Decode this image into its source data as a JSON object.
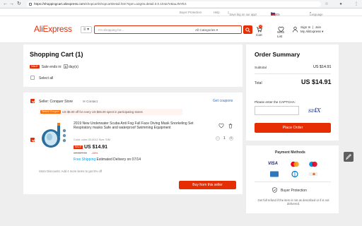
{
  "browser": {
    "url_host": "https://shoppingcart.aliexpress.com",
    "url_path": "/shopcart/shopcartDetail.htm?spm=a2g0o.detail.0.0.104a7e8auJNYE4"
  },
  "topbar": {
    "buyer_protection": "Buyer Protection",
    "help": "Help",
    "app": "Save big on our app!",
    "ship_to": "Ship to",
    "currency": "/ USD",
    "language": "Language"
  },
  "header": {
    "logo": "AliExpress",
    "search_placeholder": "I'm shopping for...",
    "search_categories": "All Categories",
    "cart_label": "Cart",
    "cart_count": "0",
    "wish_label_1": "Wish",
    "wish_label_2": "List",
    "signin": "Sign In",
    "join": "Join",
    "my_aliexpress": "My AliExpress"
  },
  "cart": {
    "title": "Shopping Cart (1)",
    "sale_tag": "SALE",
    "sale_ends": "Sale ends in:",
    "sale_days": "5",
    "sale_days_label": "day(s)",
    "select_all": "Select all"
  },
  "seller": {
    "label": "Seller: Conquer Store",
    "contact": "Contact",
    "get_coupons": "Get coupons",
    "coupon_tag": "Select Coupon",
    "coupon_text": "US $6.00 off for every US $65.00 spent in participating stores"
  },
  "item": {
    "title": "2019 New Underwater Scuba Anti Fog Full Face Diving Mask Snorkeling Set Respiratory masks Safe and waterproof Swimming Equipment",
    "variant": "Color: color-03-0012   Size: S/M",
    "sale_tag": "SALE",
    "price": "US $14.91",
    "original_price": "US $27.00",
    "discount": "-25%",
    "free_shipping": "Free Shipping",
    "delivery": "Estimated Delivery on 07/14",
    "quantity": "1",
    "qty_minus": "−",
    "qty_plus": "+"
  },
  "store_footer": {
    "store_discounts": "Store Discounts: Add 4 more items to get 5% off",
    "buy_button": "Buy from this seller"
  },
  "summary": {
    "title": "Order Summary",
    "subtotal_label": "Subtotal",
    "subtotal_value": "US $14.91",
    "total_label": "Total",
    "total_value": "US $14.91",
    "captcha_label": "Please enter the CAPTCHA:",
    "captcha_text": "sz4X",
    "place_order": "Place Order"
  },
  "payment": {
    "title": "Payment Methods",
    "methods": [
      "VISA",
      "Mastercard",
      "Maestro",
      "Amex",
      "Diners",
      "Discover"
    ]
  },
  "protection": {
    "title": "Buyer Protection",
    "text": "Get full refund if the item is not as described or if is not delivered."
  },
  "colors": {
    "brand": "#e62e04",
    "shipping": "#00a0e9"
  }
}
